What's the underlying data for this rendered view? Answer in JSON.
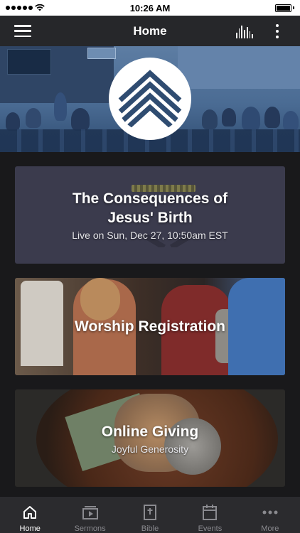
{
  "status_bar": {
    "time": "10:26 AM"
  },
  "nav": {
    "title": "Home"
  },
  "cards": [
    {
      "title": "The Consequences of Jesus' Birth",
      "subtitle": "Live on Sun, Dec 27, 10:50am EST"
    },
    {
      "title": "Worship Registration"
    },
    {
      "title": "Online Giving",
      "subtitle": "Joyful Generosity"
    }
  ],
  "tabs": [
    {
      "label": "Home",
      "icon": "home-icon",
      "active": true
    },
    {
      "label": "Sermons",
      "icon": "video-icon",
      "active": false
    },
    {
      "label": "Bible",
      "icon": "bible-icon",
      "active": false
    },
    {
      "label": "Events",
      "icon": "calendar-icon",
      "active": false
    },
    {
      "label": "More",
      "icon": "more-icon",
      "active": false
    }
  ],
  "colors": {
    "nav_background": "#26272a",
    "hero_tint": "#4a6b93",
    "tab_active": "#ffffff",
    "tab_inactive": "#8a8a8f"
  }
}
